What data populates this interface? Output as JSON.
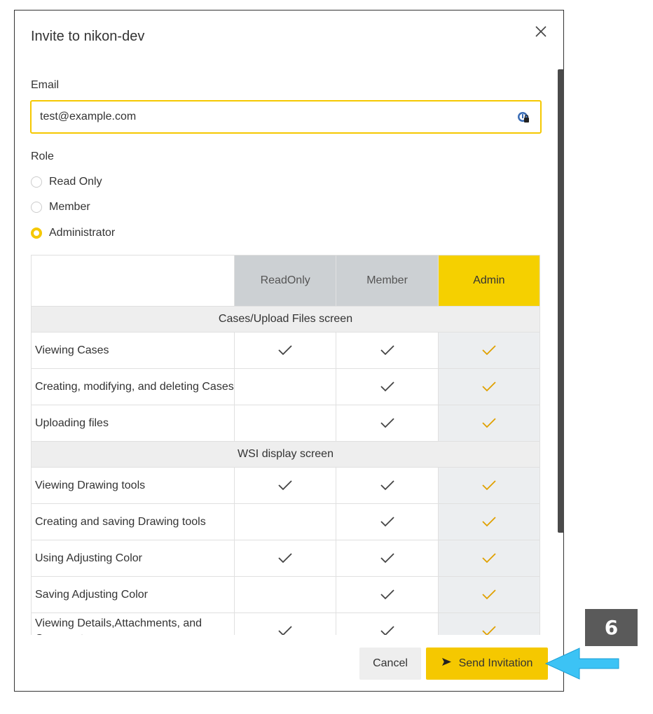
{
  "dialog": {
    "title": "Invite to nikon-dev",
    "close_icon": "close-icon"
  },
  "email": {
    "label": "Email",
    "value": "test@example.com",
    "icon": "password-manager-icon"
  },
  "role": {
    "label": "Role",
    "options": [
      {
        "label": "Read Only",
        "selected": false
      },
      {
        "label": "Member",
        "selected": false
      },
      {
        "label": "Administrator",
        "selected": true
      }
    ]
  },
  "permissions": {
    "columns": [
      "ReadOnly",
      "Member",
      "Admin"
    ],
    "sections": [
      {
        "title": "Cases/Upload Files screen",
        "rows": [
          {
            "feature": "Viewing Cases",
            "readonly": true,
            "member": true,
            "admin": true
          },
          {
            "feature": "Creating, modifying, and deleting Cases",
            "readonly": false,
            "member": true,
            "admin": true
          },
          {
            "feature": "Uploading files",
            "readonly": false,
            "member": true,
            "admin": true
          }
        ]
      },
      {
        "title": "WSI display screen",
        "rows": [
          {
            "feature": "Viewing Drawing tools",
            "readonly": true,
            "member": true,
            "admin": true
          },
          {
            "feature": "Creating and saving Drawing tools",
            "readonly": false,
            "member": true,
            "admin": true
          },
          {
            "feature": "Using Adjusting Color",
            "readonly": true,
            "member": true,
            "admin": true
          },
          {
            "feature": "Saving Adjusting Color",
            "readonly": false,
            "member": true,
            "admin": true
          },
          {
            "feature": "Viewing Details,Attachments, and Comments",
            "readonly": true,
            "member": true,
            "admin": true
          }
        ]
      }
    ]
  },
  "footer": {
    "cancel_label": "Cancel",
    "send_label": "Send Invitation",
    "send_icon": "send-icon"
  },
  "annotation": {
    "step_number": "6"
  },
  "colors": {
    "accent": "#f5c800",
    "header_gray": "#ccd0d3",
    "badge": "#5a5a5a",
    "arrow": "#3cc3f5"
  }
}
